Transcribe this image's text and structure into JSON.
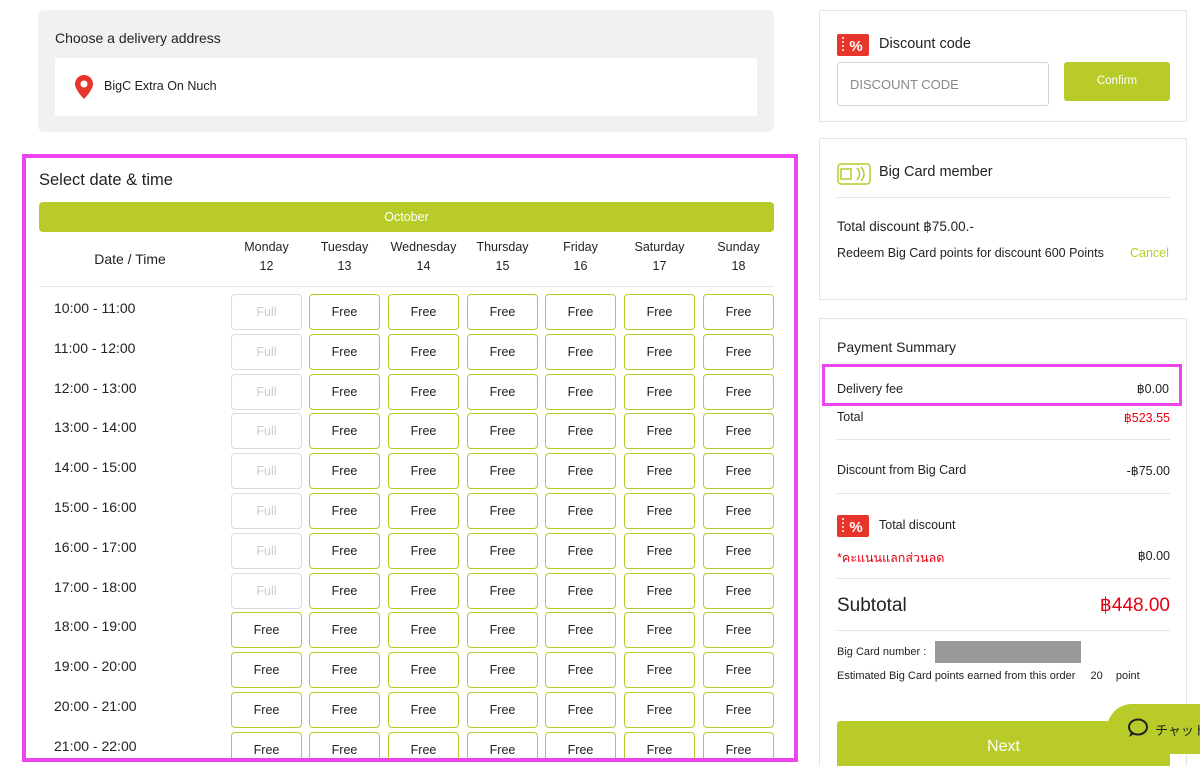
{
  "address": {
    "title": "Choose a delivery address",
    "selected": "BigC Extra On Nuch"
  },
  "schedule": {
    "title": "Select date & time",
    "month": "October",
    "header_label": "Date / Time",
    "days": [
      {
        "name": "Monday",
        "date": "12"
      },
      {
        "name": "Tuesday",
        "date": "13"
      },
      {
        "name": "Wednesday",
        "date": "14"
      },
      {
        "name": "Thursday",
        "date": "15"
      },
      {
        "name": "Friday",
        "date": "16"
      },
      {
        "name": "Saturday",
        "date": "17"
      },
      {
        "name": "Sunday",
        "date": "18"
      }
    ],
    "slots": [
      {
        "time": "10:00 - 11:00",
        "status": [
          "Full",
          "Free",
          "Free",
          "Free",
          "Free",
          "Free",
          "Free"
        ]
      },
      {
        "time": "11:00 - 12:00",
        "status": [
          "Full",
          "Free",
          "Free",
          "Free",
          "Free",
          "Free",
          "Free"
        ]
      },
      {
        "time": "12:00 - 13:00",
        "status": [
          "Full",
          "Free",
          "Free",
          "Free",
          "Free",
          "Free",
          "Free"
        ]
      },
      {
        "time": "13:00 - 14:00",
        "status": [
          "Full",
          "Free",
          "Free",
          "Free",
          "Free",
          "Free",
          "Free"
        ]
      },
      {
        "time": "14:00 - 15:00",
        "status": [
          "Full",
          "Free",
          "Free",
          "Free",
          "Free",
          "Free",
          "Free"
        ]
      },
      {
        "time": "15:00 - 16:00",
        "status": [
          "Full",
          "Free",
          "Free",
          "Free",
          "Free",
          "Free",
          "Free"
        ]
      },
      {
        "time": "16:00 - 17:00",
        "status": [
          "Full",
          "Free",
          "Free",
          "Free",
          "Free",
          "Free",
          "Free"
        ]
      },
      {
        "time": "17:00 - 18:00",
        "status": [
          "Full",
          "Free",
          "Free",
          "Free",
          "Free",
          "Free",
          "Free"
        ]
      },
      {
        "time": "18:00 - 19:00",
        "status": [
          "Free",
          "Free",
          "Free",
          "Free",
          "Free",
          "Free",
          "Free"
        ]
      },
      {
        "time": "19:00 - 20:00",
        "status": [
          "Free",
          "Free",
          "Free",
          "Free",
          "Free",
          "Free",
          "Free"
        ]
      },
      {
        "time": "20:00 - 21:00",
        "status": [
          "Free",
          "Free",
          "Free",
          "Free",
          "Free",
          "Free",
          "Free"
        ]
      },
      {
        "time": "21:00 - 22:00",
        "status": [
          "Free",
          "Free",
          "Free",
          "Free",
          "Free",
          "Free",
          "Free"
        ]
      }
    ]
  },
  "discount": {
    "title": "Discount code",
    "placeholder": "DISCOUNT CODE",
    "confirm_label": "Confirm"
  },
  "bigcard": {
    "title": "Big Card member",
    "total_discount": "Total discount ฿75.00.-",
    "redeem_text": "Redeem Big Card points for discount 600 Points",
    "cancel_label": "Cancel"
  },
  "summary": {
    "title": "Payment Summary",
    "delivery_fee_label": "Delivery fee",
    "delivery_fee_value": "฿0.00",
    "total_label": "Total",
    "total_value": "฿523.55",
    "bigcard_discount_label": "Discount from Big Card",
    "bigcard_discount_value": "-฿75.00",
    "total_discount_label": "Total discount",
    "points_note": "*คะแนนแลกส่วนลด",
    "points_value": "฿0.00",
    "subtotal_label": "Subtotal",
    "subtotal_value": "฿448.00",
    "card_number_label": "Big Card number :",
    "earned_label": "Estimated Big Card points earned from this order",
    "earned_points": "20",
    "earned_unit": "point",
    "next_label": "Next"
  },
  "chat": {
    "label": "チャット"
  },
  "colors": {
    "accent": "#b8cb28",
    "highlight": "#ee44ee",
    "price_red": "#e60012",
    "discount_icon_red": "#e8352b"
  }
}
